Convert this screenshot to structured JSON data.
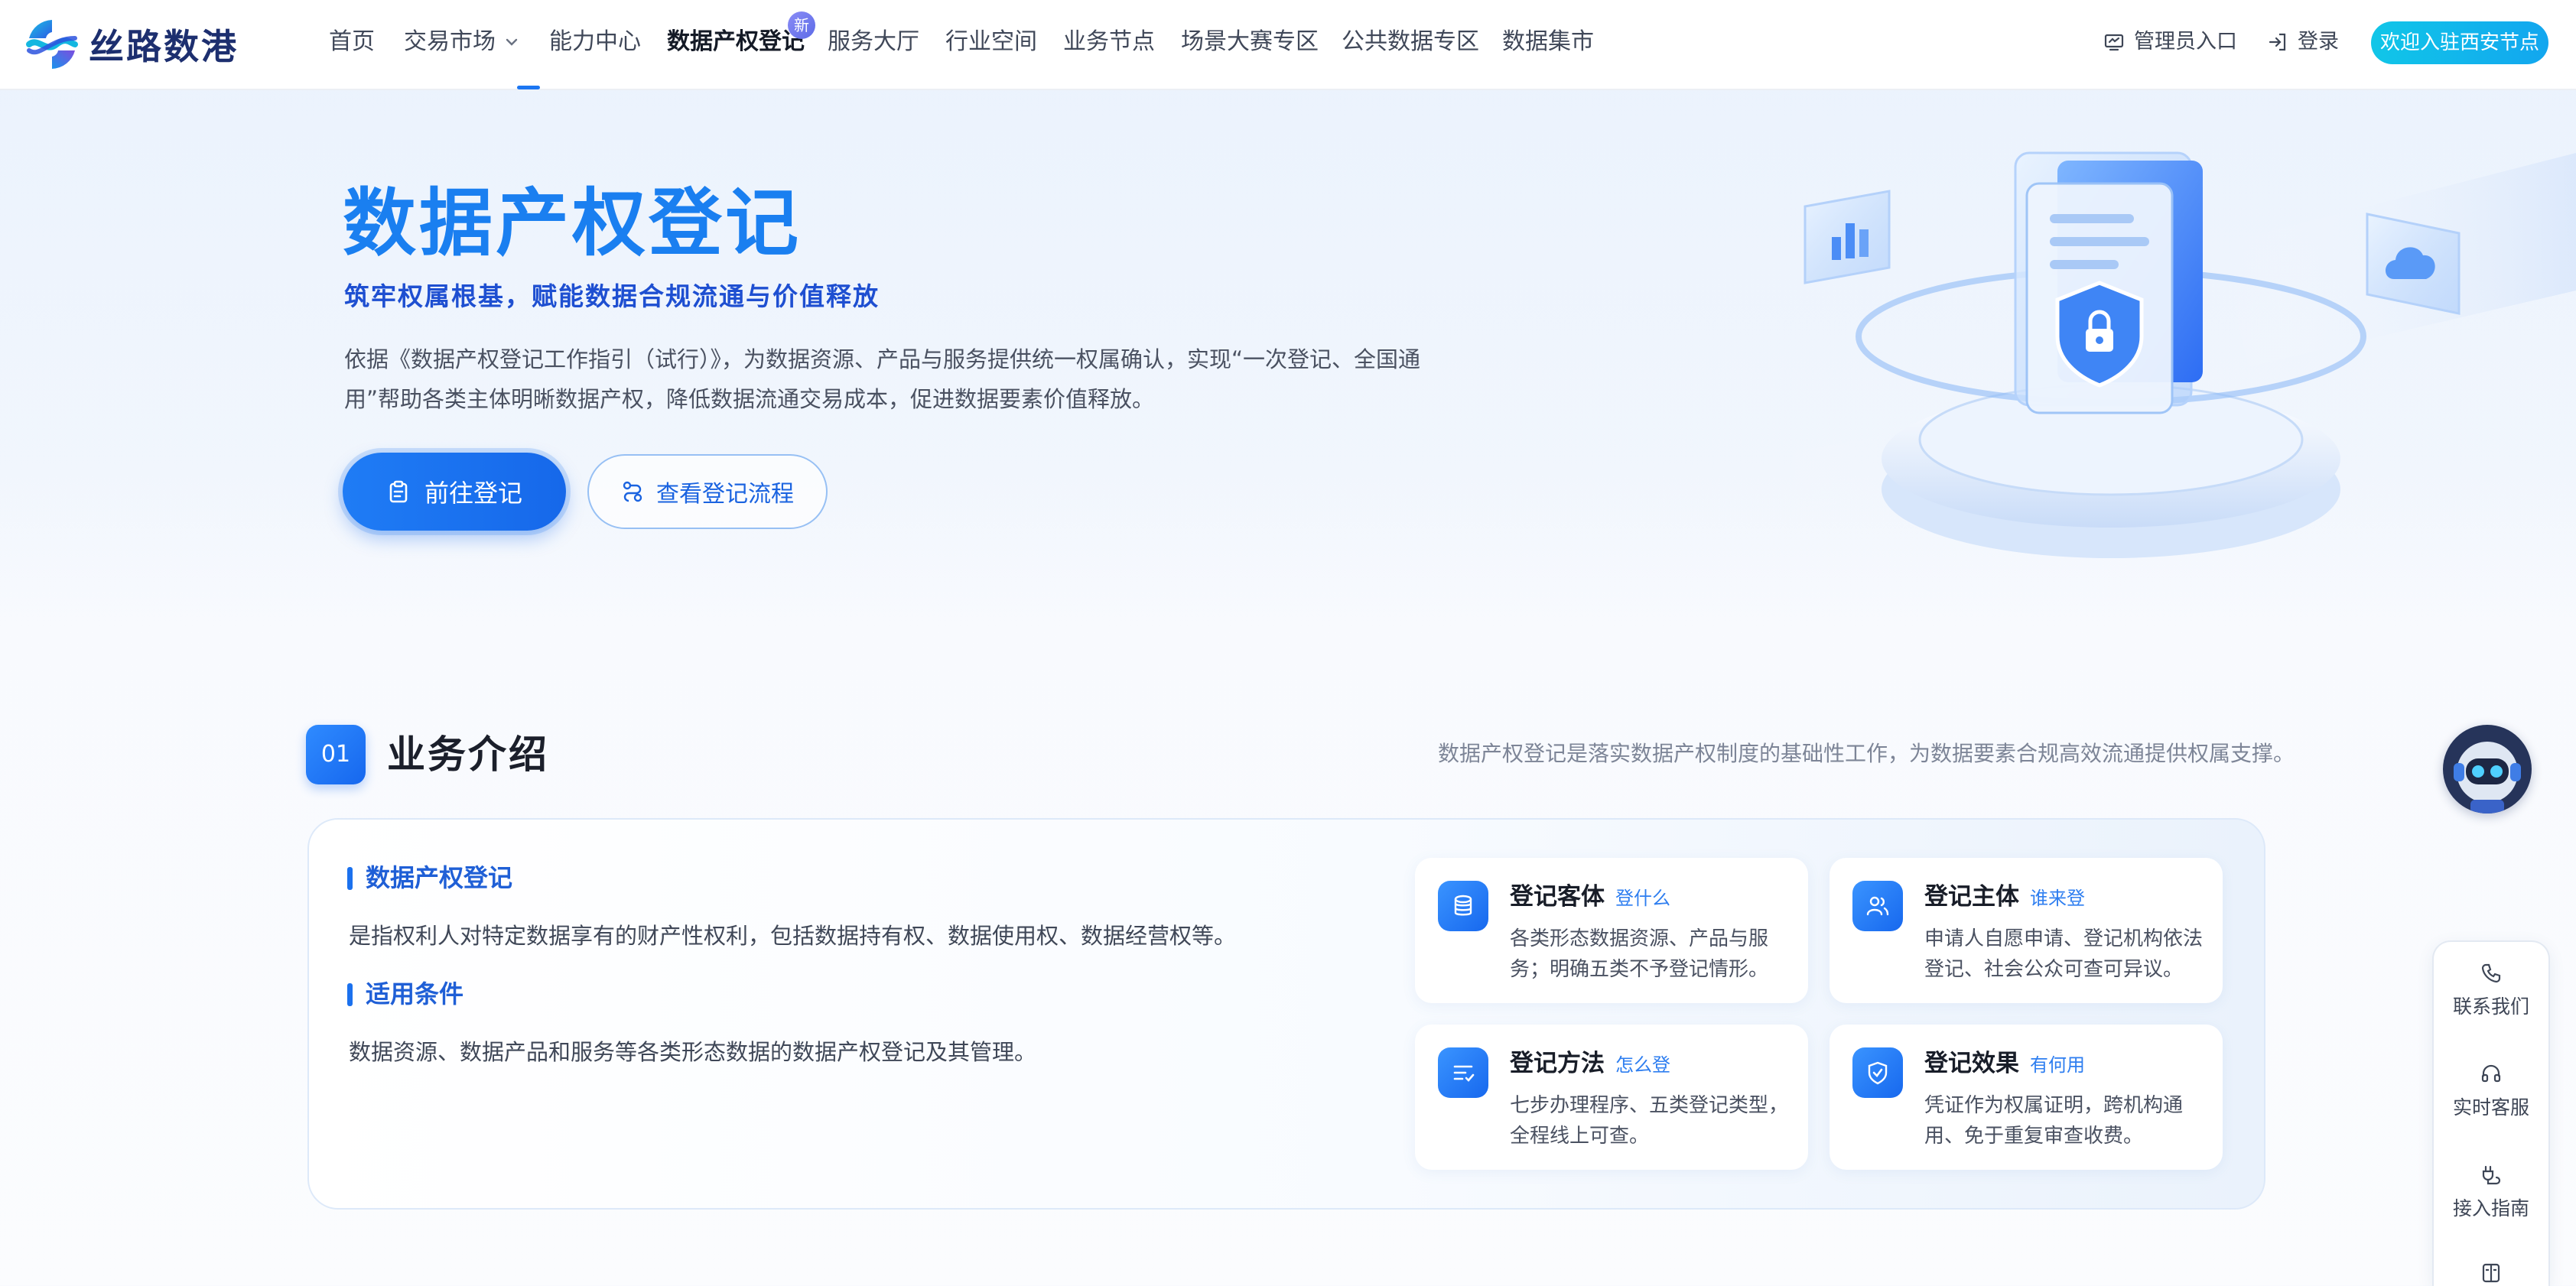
{
  "nav": {
    "brand": "丝路数港",
    "items": [
      "首页",
      "交易市场",
      "能力中心",
      "数据产权登记",
      "服务大厅",
      "行业空间",
      "业务节点",
      "场景大赛专区",
      "公共数据专区",
      "数据集市"
    ],
    "new_badge": "新",
    "admin_label": "管理员入口",
    "login_label": "登录",
    "welcome_button": "欢迎入驻西安节点"
  },
  "hero": {
    "title": "数据产权登记",
    "subtitle": "筑牢权属根基，赋能数据合规流通与价值释放",
    "desc_line1": "依据《数据产权登记工作指引（试行）》，为数据资源、产品与服务提供统一权属确认，实现“一次登记、全国通",
    "desc_line2": "用”帮助各类主体明晰数据产权，降低数据流通交易成本，促进数据要素价值释放。",
    "primary_button": "前往登记",
    "secondary_button": "查看登记流程"
  },
  "section": {
    "number": "01",
    "title": "业务介绍",
    "note": "数据产权登记是落实数据产权制度的基础性工作，为数据要素合规高效流通提供权属支撑。",
    "intro_label": "数据产权登记",
    "intro_text": "是指权利人对特定数据享有的财产性权利，包括数据持有权、数据使用权、数据经营权等。",
    "scope_label": "适用条件",
    "scope_text": "数据资源、数据产品和服务等各类形态数据的数据产权登记及其管理。",
    "features": [
      {
        "title": "登记客体",
        "tag": "登什么",
        "desc": "各类形态数据资源、产品与服务；明确五类不予登记情形。",
        "icon": "database-icon"
      },
      {
        "title": "登记主体",
        "tag": "谁来登",
        "desc": "申请人自愿申请、登记机构依法登记、社会公众可查可异议。",
        "icon": "users-icon"
      },
      {
        "title": "登记方法",
        "tag": "怎么登",
        "desc": "七步办理程序、五类登记类型，全程线上可查。",
        "icon": "list-check-icon"
      },
      {
        "title": "登记效果",
        "tag": "有何用",
        "desc": "凭证作为权属证明，跨机构通用、免于重复审查收费。",
        "icon": "shield-check-icon"
      }
    ]
  },
  "side": {
    "items": [
      "联系我们",
      "实时客服",
      "接入指南"
    ]
  },
  "colors": {
    "primary": "#1C76F2",
    "title_gradient_start": "#0FB5EE",
    "welcome": "#12B3EC"
  }
}
